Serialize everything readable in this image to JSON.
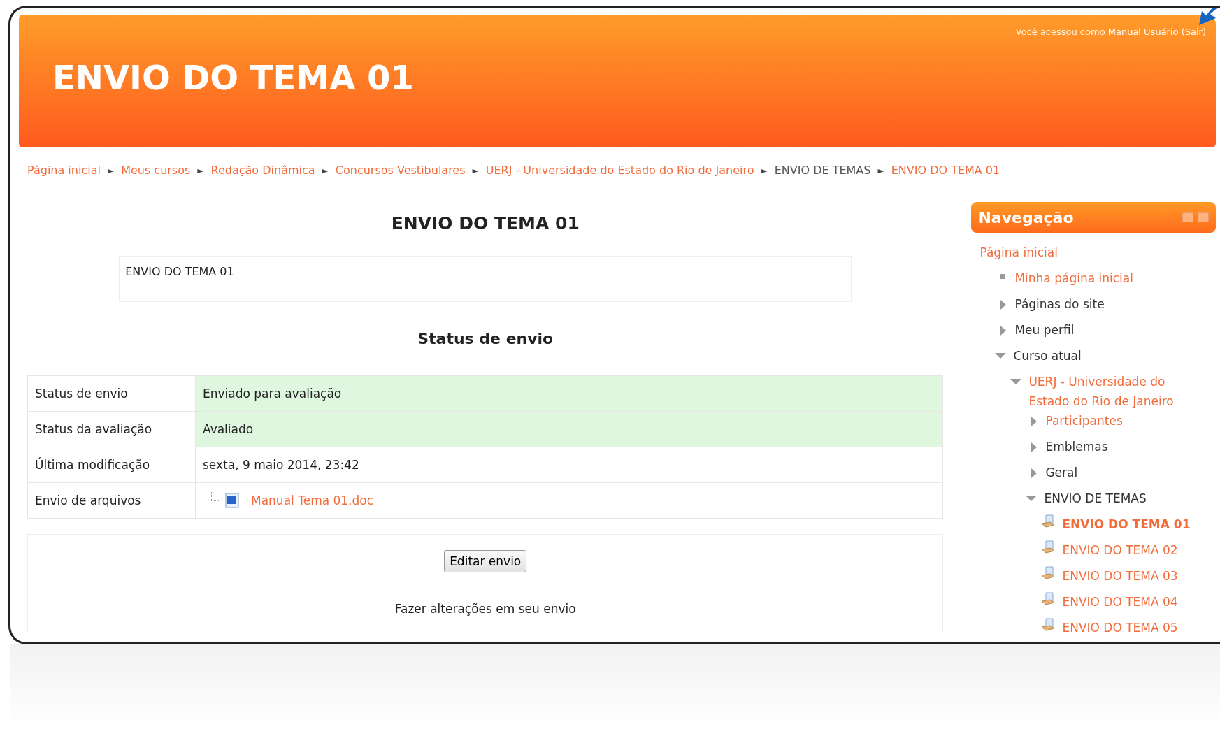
{
  "header": {
    "title": "ENVIO DO TEMA 01",
    "login": {
      "prefix": "Você acessou como",
      "user": "Manual Usuário",
      "logout_open": "(",
      "logout": "Sair",
      "logout_close": ")"
    }
  },
  "breadcrumb": [
    {
      "label": "Página inicial",
      "link": true
    },
    {
      "label": "Meus cursos",
      "link": true
    },
    {
      "label": "Redação Dinâmica",
      "link": true
    },
    {
      "label": "Concursos Vestibulares",
      "link": true
    },
    {
      "label": "UERJ - Universidade do Estado do Rio de Janeiro",
      "link": true
    },
    {
      "label": "ENVIO DE TEMAS",
      "link": false
    },
    {
      "label": "ENVIO DO TEMA 01",
      "link": true
    }
  ],
  "breadcrumb_separator": "►",
  "main": {
    "heading": "ENVIO DO TEMA 01",
    "intro": "ENVIO DO TEMA 01",
    "status_heading": "Status de envio",
    "rows": [
      {
        "label": "Status de envio",
        "value": "Enviado para avaliação",
        "kind": "text",
        "highlight": true
      },
      {
        "label": "Status da avaliação",
        "value": "Avaliado",
        "kind": "text",
        "highlight": true
      },
      {
        "label": "Última modificação",
        "value": "sexta, 9 maio 2014, 23:42",
        "kind": "text",
        "highlight": false
      },
      {
        "label": "Envio de arquivos",
        "value": "Manual Tema 01.doc",
        "kind": "file",
        "highlight": false
      }
    ],
    "button": "Editar envio",
    "note": "Fazer alterações em seu envio"
  },
  "navigation": {
    "title": "Navegação",
    "items": [
      {
        "label": "Página inicial",
        "kind": "root",
        "link": true,
        "children": [
          {
            "label": "Minha página inicial",
            "kind": "leaf",
            "link": true
          },
          {
            "label": "Páginas do site",
            "kind": "branch",
            "expanded": false,
            "link": false
          },
          {
            "label": "Meu perfil",
            "kind": "branch",
            "expanded": false,
            "link": false
          },
          {
            "label": "Curso atual",
            "kind": "branch",
            "expanded": true,
            "link": false,
            "children": [
              {
                "label": "UERJ - Universidade do Estado do Rio de Janeiro",
                "kind": "branch",
                "expanded": true,
                "link": true,
                "children": [
                  {
                    "label": "Participantes",
                    "kind": "branch",
                    "expanded": false,
                    "link": true
                  },
                  {
                    "label": "Emblemas",
                    "kind": "branch",
                    "expanded": false,
                    "link": false
                  },
                  {
                    "label": "Geral",
                    "kind": "branch",
                    "expanded": false,
                    "link": false
                  },
                  {
                    "label": "ENVIO DE TEMAS",
                    "kind": "branch",
                    "expanded": true,
                    "link": false,
                    "children": [
                      {
                        "label": "ENVIO DO TEMA 01",
                        "kind": "activity",
                        "link": true,
                        "selected": true
                      },
                      {
                        "label": "ENVIO DO TEMA 02",
                        "kind": "activity",
                        "link": true,
                        "selected": false
                      },
                      {
                        "label": "ENVIO DO TEMA 03",
                        "kind": "activity",
                        "link": true,
                        "selected": false
                      },
                      {
                        "label": "ENVIO DO TEMA 04",
                        "kind": "activity",
                        "link": true,
                        "selected": false
                      },
                      {
                        "label": "ENVIO DO TEMA 05",
                        "kind": "activity",
                        "link": true,
                        "selected": false
                      }
                    ]
                  }
                ]
              }
            ]
          }
        ]
      }
    ]
  }
}
